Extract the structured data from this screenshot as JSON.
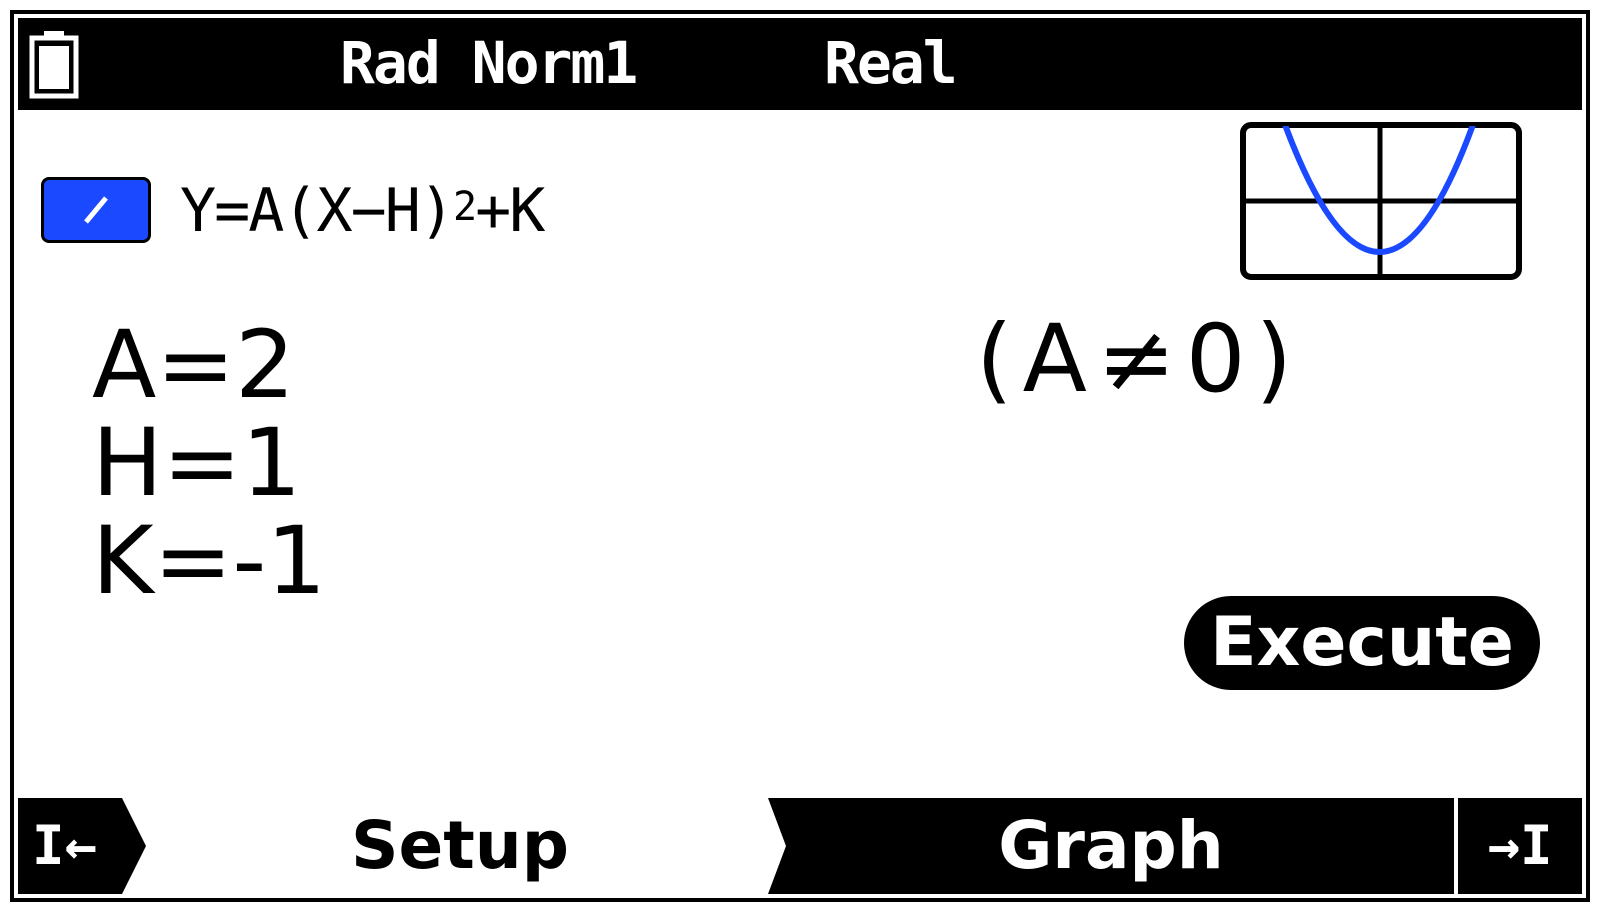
{
  "status_bar": {
    "angle_mode": "Rad Norm1",
    "complex_mode": "Real",
    "battery_icon": "battery-icon"
  },
  "equation": {
    "prefix": "Y=A(X−H)",
    "exponent": "2",
    "suffix": "+K",
    "toggle_icon": "graph-line-icon",
    "toggle_color": "#1a49ff"
  },
  "preview": {
    "icon": "parabola-preview-icon",
    "curve_color": "#1a49ff"
  },
  "parameters": {
    "a": "A=2",
    "h": "H=1",
    "k": "K=-1"
  },
  "constraint": "(A≠0)",
  "execute_label": "Execute",
  "tabs": {
    "prev_label": "I←",
    "setup_label": "Setup",
    "graph_label": "Graph",
    "next_label": "→I"
  }
}
